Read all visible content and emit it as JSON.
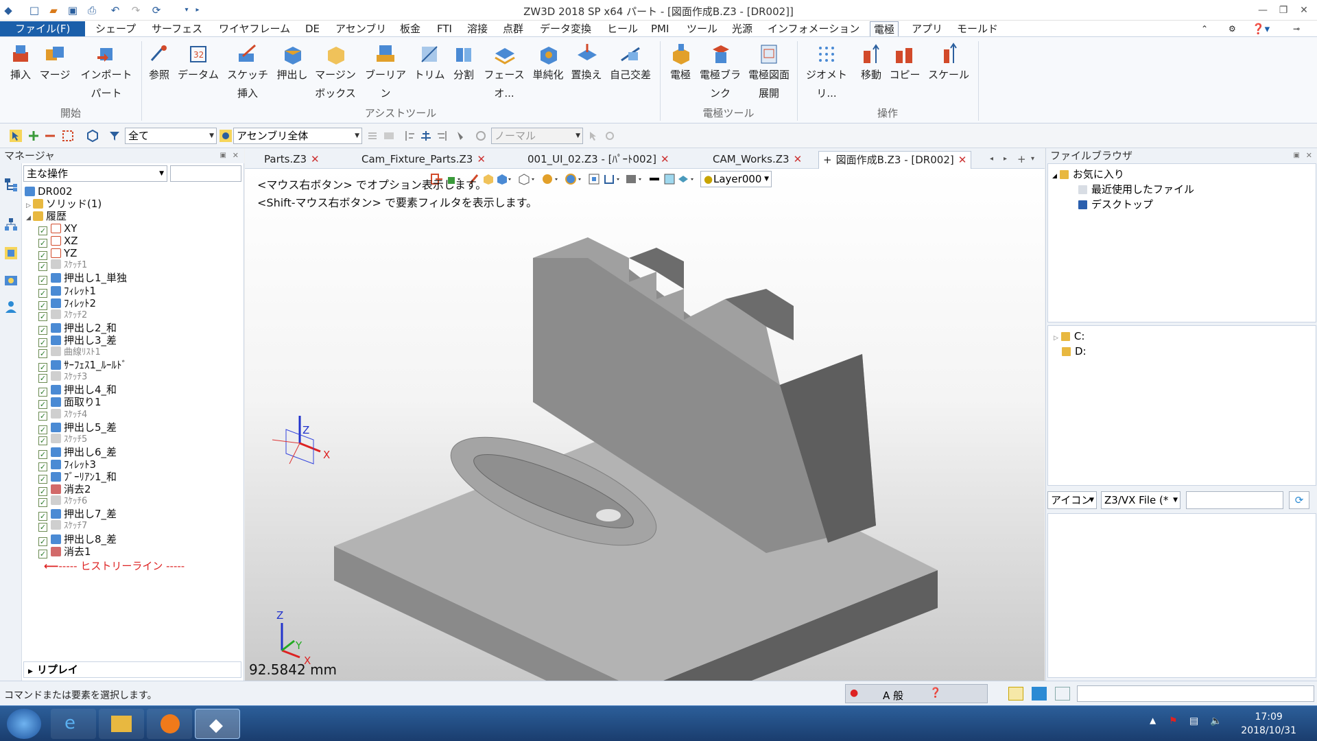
{
  "window": {
    "title": "ZW3D 2018 SP x64          パート - [図面作成B.Z3 - [DR002]]"
  },
  "menubar": {
    "file": "ファイル(F)",
    "items": [
      "シェープ",
      "サーフェス",
      "ワイヤフレーム",
      "DE",
      "アセンブリ",
      "板金",
      "FTI",
      "溶接",
      "点群",
      "データ変換",
      "ヒール",
      "PMI",
      "ツール",
      "光源",
      "インフォメーション",
      "電極",
      "アプリ",
      "モールド"
    ],
    "active": "電極"
  },
  "ribbon": {
    "groups": [
      "開始",
      "アシストツール",
      "電極ツール",
      "操作"
    ],
    "buttons": [
      {
        "l1": "挿入",
        "l2": ""
      },
      {
        "l1": "マージ",
        "l2": ""
      },
      {
        "l1": "インポート",
        "l2": "パート"
      },
      {
        "l1": "参照",
        "l2": ""
      },
      {
        "l1": "データム",
        "l2": ""
      },
      {
        "l1": "スケッチ",
        "l2": "挿入"
      },
      {
        "l1": "押出し",
        "l2": ""
      },
      {
        "l1": "マージン",
        "l2": "ボックス"
      },
      {
        "l1": "ブーリア",
        "l2": "ン"
      },
      {
        "l1": "トリム",
        "l2": ""
      },
      {
        "l1": "分割",
        "l2": ""
      },
      {
        "l1": "フェース",
        "l2": "オ..."
      },
      {
        "l1": "単純化",
        "l2": ""
      },
      {
        "l1": "置換え",
        "l2": ""
      },
      {
        "l1": "自己交差",
        "l2": ""
      },
      {
        "l1": "電極",
        "l2": ""
      },
      {
        "l1": "電極ブラ",
        "l2": "ンク"
      },
      {
        "l1": "電極図面",
        "l2": "展開"
      },
      {
        "l1": "ジオメト",
        "l2": "リ..."
      },
      {
        "l1": "移動",
        "l2": ""
      },
      {
        "l1": "コピー",
        "l2": ""
      },
      {
        "l1": "スケール",
        "l2": ""
      }
    ]
  },
  "toolbar": {
    "filter": "全て",
    "scope": "アセンブリ全体",
    "mode": "ノーマル"
  },
  "manager": {
    "title": "マネージャ",
    "combo": "主な操作",
    "root": "DR002",
    "solid": "ソリッド(1)",
    "history": "履歴",
    "items": [
      "XY",
      "XZ",
      "YZ",
      "ｽｹｯﾁ1",
      "押出し1_単独",
      "ﾌｨﾚｯﾄ1",
      "ﾌｨﾚｯﾄ2",
      "ｽｹｯﾁ2",
      "押出し2_和",
      "押出し3_差",
      "曲線ﾘｽﾄ1",
      "ｻｰﾌｪｽ1_ﾙｰﾙﾄﾞ",
      "ｽｹｯﾁ3",
      "押出し4_和",
      "面取り1",
      "ｽｹｯﾁ4",
      "押出し5_差",
      "ｽｹｯﾁ5",
      "押出し6_差",
      "ﾌｨﾚｯﾄ3",
      "ﾌﾞｰﾘｱﾝ1_和",
      "消去2",
      "ｽｹｯﾁ6",
      "押出し7_差",
      "ｽｹｯﾁ7",
      "押出し8_差",
      "消去1"
    ],
    "history_line": "----- ヒストリーライン -----",
    "replay": "リプレイ"
  },
  "tabs": [
    {
      "label": "Parts.Z3"
    },
    {
      "label": "Cam_Fixture_Parts.Z3"
    },
    {
      "label": "001_UI_02.Z3 - [ﾊﾟｰﾄ002]"
    },
    {
      "label": "CAM_Works.Z3"
    },
    {
      "label": "図面作成B.Z3 - [DR002]"
    }
  ],
  "viewport": {
    "layer": "Layer000",
    "hint1": "<マウス右ボタン> でオプション表示します。",
    "hint2": "<Shift-マウス右ボタン> で要素フィルタを表示します。",
    "measure": "92.5842 mm",
    "axis": {
      "x": "X",
      "y": "Y",
      "z": "Z"
    }
  },
  "filebrowser": {
    "title": "ファイルブラウザ",
    "favorites": "お気に入り",
    "recent": "最近使用したファイル",
    "desktop": "デスクトップ",
    "drives": [
      "C:",
      "D:"
    ],
    "icon_mode": "アイコン",
    "filetype": "Z3/VX File (*"
  },
  "status": {
    "text": "コマンドまたは要素を選択します。",
    "ime": "A 般"
  },
  "clock": {
    "time": "17:09",
    "date": "2018/10/31"
  },
  "colors": {
    "file_menu": "#1b5faa",
    "accent": "#2b5f9e",
    "taskbar": "#1a3d6e"
  }
}
